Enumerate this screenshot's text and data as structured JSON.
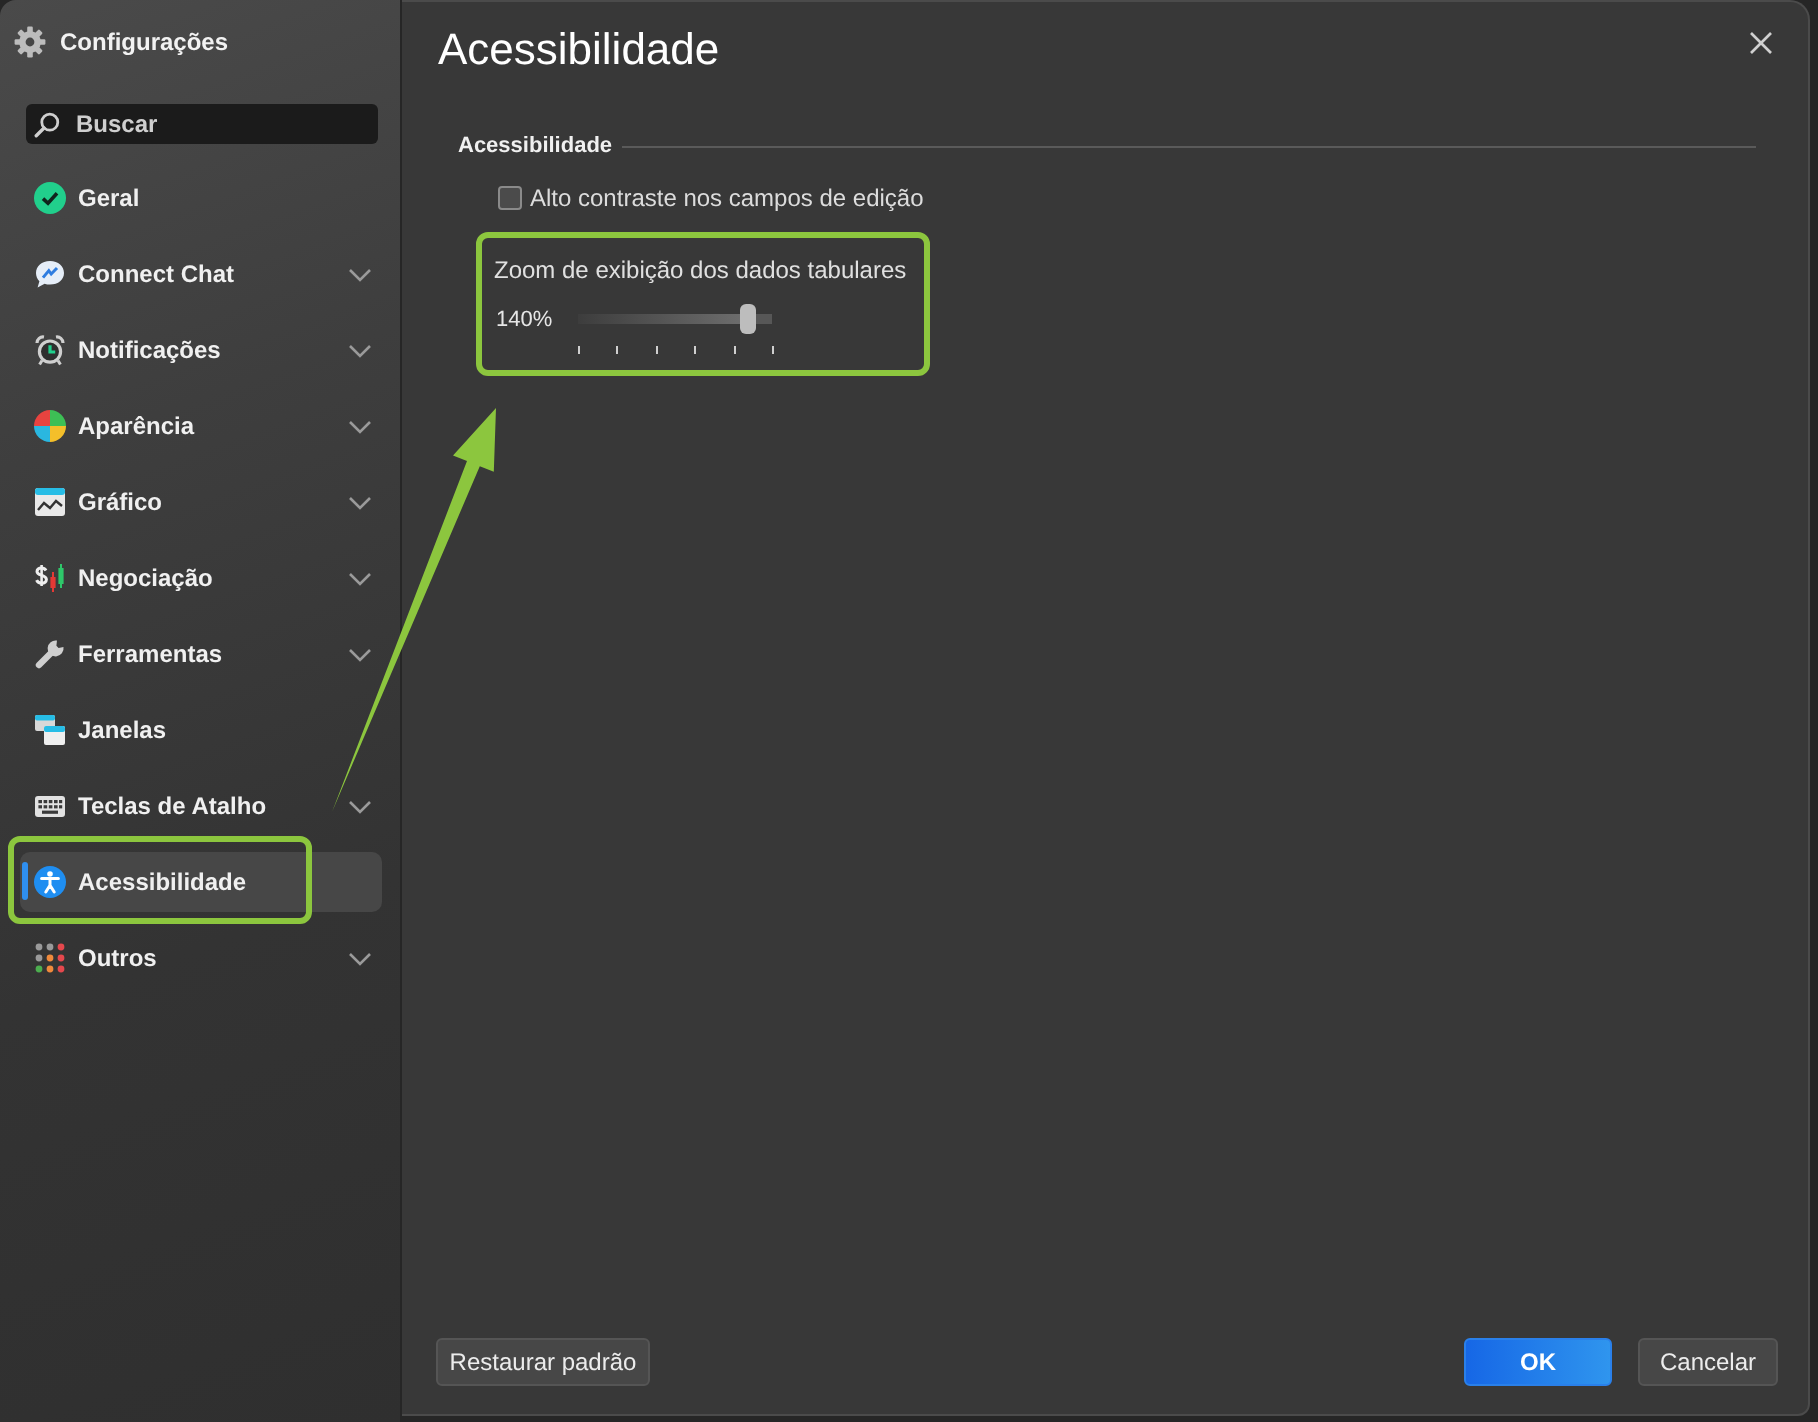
{
  "sidebar": {
    "title": "Configurações",
    "search": {
      "placeholder": "Buscar"
    },
    "items": [
      {
        "label": "Geral",
        "expandable": false,
        "selected": false,
        "highlighted": false
      },
      {
        "label": "Connect Chat",
        "expandable": true,
        "selected": false,
        "highlighted": false
      },
      {
        "label": "Notificações",
        "expandable": true,
        "selected": false,
        "highlighted": false
      },
      {
        "label": "Aparência",
        "expandable": true,
        "selected": false,
        "highlighted": false
      },
      {
        "label": "Gráfico",
        "expandable": true,
        "selected": false,
        "highlighted": false
      },
      {
        "label": "Negociação",
        "expandable": true,
        "selected": false,
        "highlighted": false
      },
      {
        "label": "Ferramentas",
        "expandable": true,
        "selected": false,
        "highlighted": false
      },
      {
        "label": "Janelas",
        "expandable": false,
        "selected": false,
        "highlighted": false
      },
      {
        "label": "Teclas de Atalho",
        "expandable": true,
        "selected": false,
        "highlighted": false
      },
      {
        "label": "Acessibilidade",
        "expandable": false,
        "selected": true,
        "highlighted": true
      },
      {
        "label": "Outros",
        "expandable": true,
        "selected": false,
        "highlighted": false
      }
    ]
  },
  "panel": {
    "title": "Acessibilidade",
    "section": {
      "title": "Acessibilidade",
      "checkbox": {
        "label": "Alto contraste nos campos de edição",
        "checked": false
      },
      "zoom": {
        "label": "Zoom de exibição dos dados tabulares",
        "reading": "140%",
        "level": 0.88,
        "highlighted": true
      }
    }
  },
  "annotation": {
    "arrow": true
  },
  "footer": {
    "reset_button": "Restaurar padrão",
    "buttons": [
      {
        "label": "OK",
        "primary": true
      },
      {
        "label": "Cancelar",
        "primary": false
      }
    ]
  }
}
